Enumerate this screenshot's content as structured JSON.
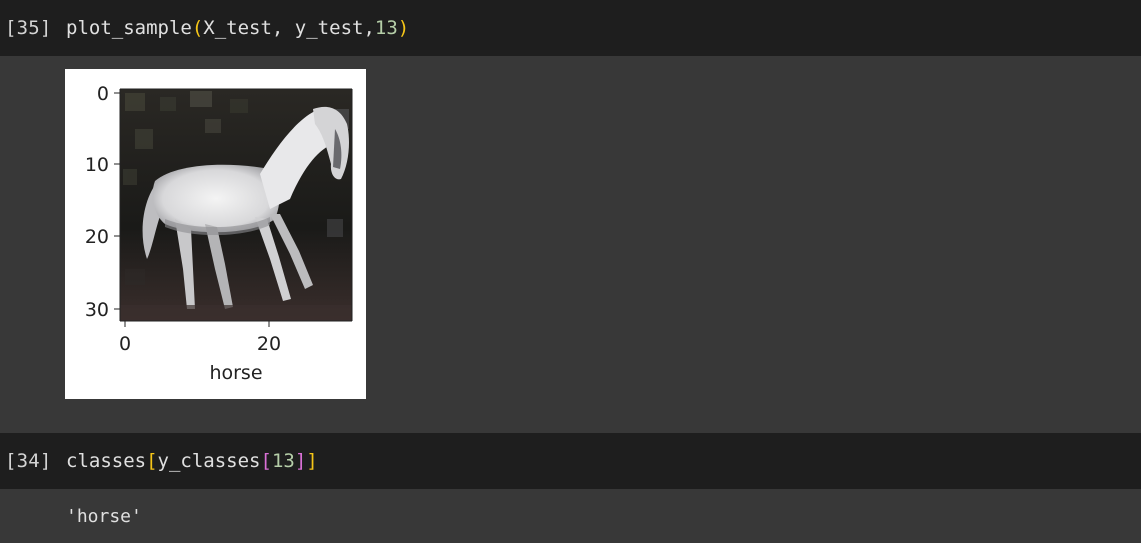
{
  "cells": [
    {
      "exec_count": "[35]",
      "code_parts": {
        "fn": "plot_sample",
        "open": "(",
        "args": "X_test, y_test,",
        "num": "13",
        "close": ")"
      }
    },
    {
      "exec_count": "[34]",
      "code_parts": {
        "fn": "classes",
        "open": "[",
        "inner": "y_classes",
        "open2": "[",
        "num": "13",
        "close2": "]",
        "close": "]"
      },
      "output_text": "'horse'"
    }
  ],
  "figure": {
    "y_ticks": [
      "0",
      "10",
      "20",
      "30"
    ],
    "x_ticks": [
      "0",
      "20"
    ],
    "xlabel": "horse",
    "image_description_label": "horse"
  }
}
